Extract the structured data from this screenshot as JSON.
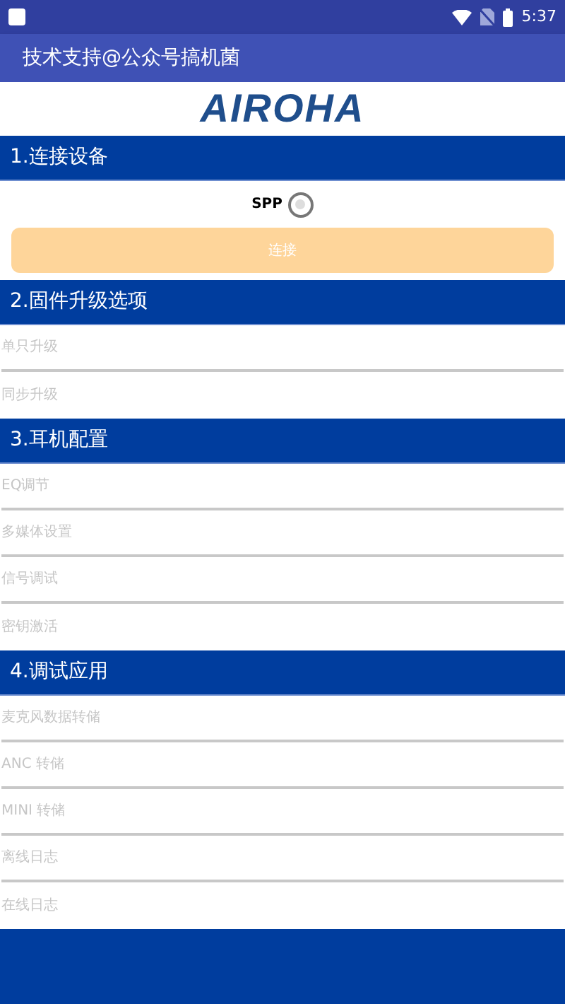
{
  "status_bar": {
    "time": "5:37"
  },
  "app_bar": {
    "title": "技术支持@公众号搞机菌"
  },
  "logo": {
    "text": "AIROHA"
  },
  "sections": [
    {
      "title": "1.连接设备",
      "kind": "connect",
      "radio": {
        "label": "SPP",
        "checked": false
      },
      "button": {
        "label": "连接",
        "disabled": true
      }
    },
    {
      "title": "2.固件升级选项",
      "kind": "list",
      "items": [
        {
          "label": "单只升级",
          "disabled": true
        },
        {
          "label": "同步升级",
          "disabled": true
        }
      ]
    },
    {
      "title": "3.耳机配置",
      "kind": "list",
      "items": [
        {
          "label": "EQ调节",
          "disabled": true
        },
        {
          "label": "多媒体设置",
          "disabled": true
        },
        {
          "label": "信号调试",
          "disabled": true
        },
        {
          "label": "密钥激活",
          "disabled": true
        }
      ]
    },
    {
      "title": "4.调试应用",
      "kind": "list",
      "items": [
        {
          "label": "麦克风数据转储",
          "disabled": true
        },
        {
          "label": "ANC 转储",
          "disabled": true
        },
        {
          "label": "MINI 转储",
          "disabled": true
        },
        {
          "label": "离线日志",
          "disabled": true
        },
        {
          "label": "在线日志",
          "disabled": true
        }
      ]
    }
  ]
}
